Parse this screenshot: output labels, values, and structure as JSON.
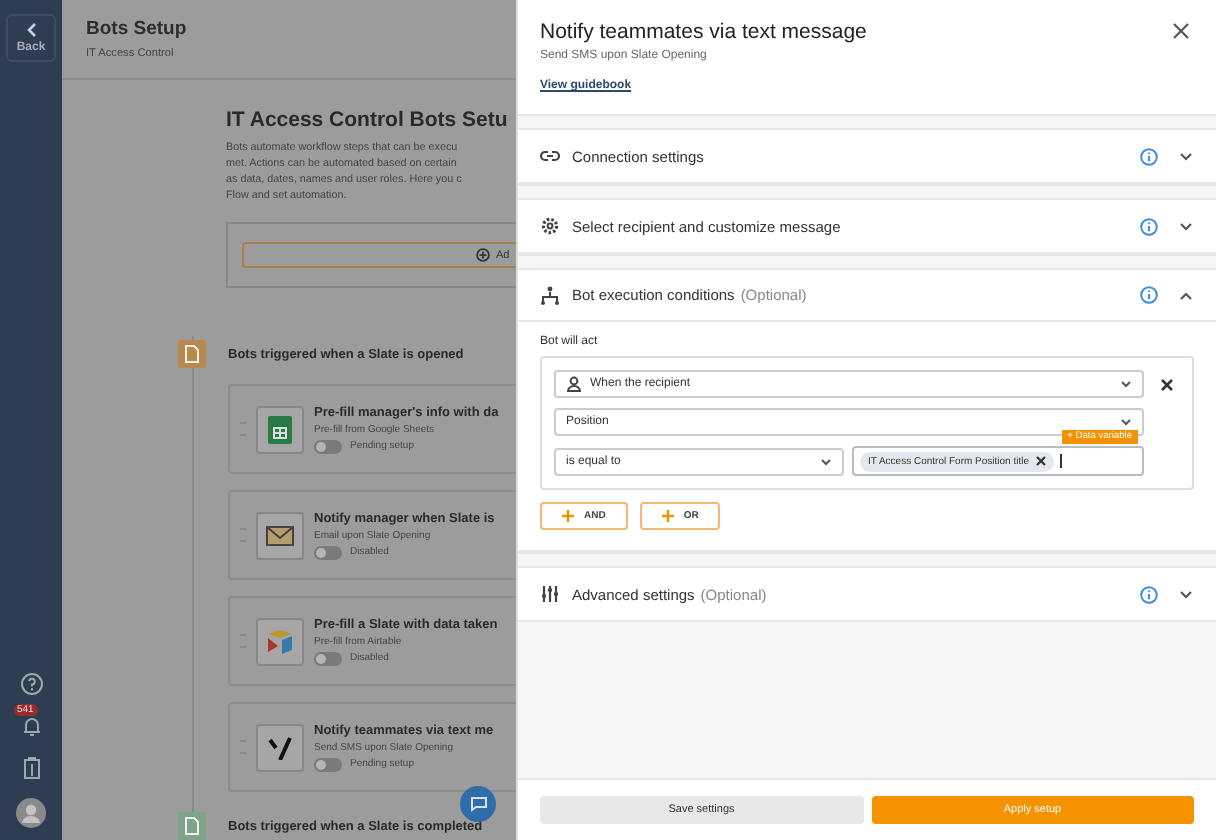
{
  "sidebar": {
    "back": "Back",
    "notification_count": "541"
  },
  "page": {
    "title": "Bots Setup",
    "subtitle": "IT Access Control",
    "heading": "IT Access Control Bots Setu",
    "description_lines": [
      "Bots automate workflow steps that can be execu",
      "met. Actions can be automated based on certain",
      "as data, dates, names and user roles. Here you c",
      "Flow and set automation."
    ],
    "add_button": "Ad",
    "groups": [
      {
        "title": "Bots triggered when a Slate is opened",
        "kind": "opened",
        "bots": [
          {
            "title": "Pre-fill manager's info with da",
            "subtitle": "Pre-fill from Google Sheets",
            "status": "Pending setup",
            "on": false,
            "kind": "sheets"
          },
          {
            "title": "Notify manager when Slate is",
            "subtitle": "Email upon Slate Opening",
            "status": "Disabled",
            "on": false,
            "kind": "email"
          },
          {
            "title": "Pre-fill a Slate with data taken",
            "subtitle": "Pre-fill from Airtable",
            "status": "Disabled",
            "on": false,
            "kind": "airtable"
          },
          {
            "title": "Notify teammates via text me",
            "subtitle": "Send SMS upon Slate Opening",
            "status": "Pending setup",
            "on": false,
            "kind": "sms"
          }
        ]
      },
      {
        "title": "Bots triggered when a Slate is completed",
        "kind": "completed"
      }
    ]
  },
  "panel": {
    "title": "Notify teammates via text message",
    "subtitle": "Send SMS upon Slate Opening",
    "link": "View guidebook",
    "sections": [
      {
        "kind": "connection",
        "title": "Connection settings",
        "expanded": false
      },
      {
        "kind": "recipient",
        "title": "Select recipient and customize message",
        "expanded": false
      },
      {
        "kind": "conditions",
        "title": "Bot execution conditions",
        "optional": "(Optional)",
        "expanded": true
      },
      {
        "kind": "advanced",
        "title": "Advanced settings",
        "optional": "(Optional)",
        "expanded": false
      }
    ],
    "conditions": {
      "label": "Bot will act",
      "subject": "When the recipient",
      "field": "Position",
      "operator": "is equal to",
      "value_chip": "IT Access Control Form Position title",
      "data_variable": "+ Data variable",
      "buttons": [
        "AND",
        "OR"
      ]
    },
    "footer": {
      "save": "Save settings",
      "apply": "Apply setup"
    }
  }
}
